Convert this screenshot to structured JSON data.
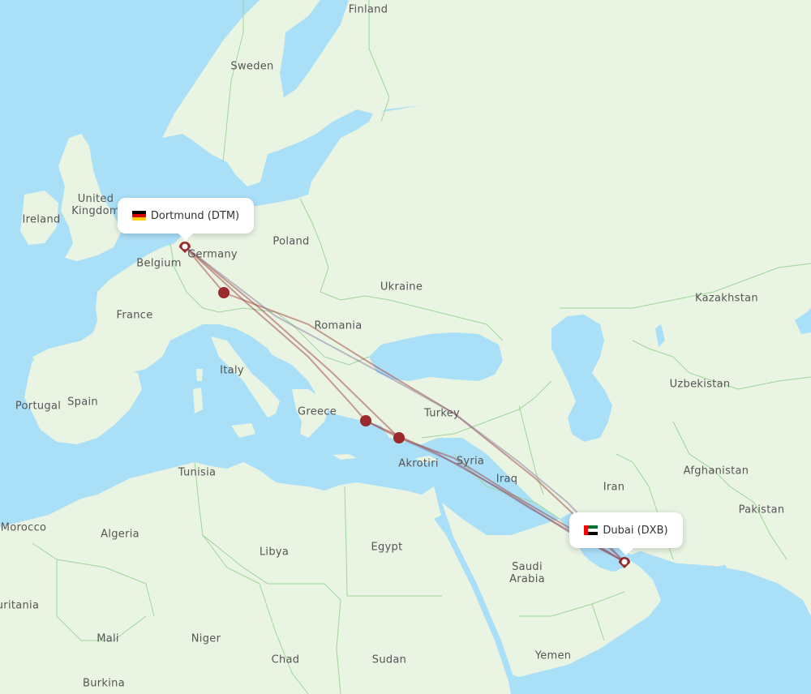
{
  "map": {
    "colors": {
      "water": "#aadff8",
      "land": "#eaf4e3",
      "border": "#9fd49a",
      "route": "#a0403f",
      "marker": "#9a2a2c"
    },
    "origin": {
      "label": "Dortmund (DTM)",
      "city": "Dortmund",
      "code": "DTM",
      "flag": "germany-flag"
    },
    "destination": {
      "label": "Dubai (DXB)",
      "city": "Dubai",
      "code": "DXB",
      "flag": "uae-flag"
    },
    "stopovers": [
      "Munich area",
      "Izmir area",
      "Antalya area"
    ],
    "country_labels": {
      "finland": "Finland",
      "sweden": "Sweden",
      "united_kingdom": "United\nKingdom",
      "ireland": "Ireland",
      "poland": "Poland",
      "germany": "Germany",
      "belgium": "Belgium",
      "ukraine": "Ukraine",
      "france": "France",
      "romania": "Romania",
      "kazakhstan": "Kazakhstan",
      "italy": "Italy",
      "uzbekistan": "Uzbekistan",
      "portugal": "Portugal",
      "spain": "Spain",
      "greece": "Greece",
      "turkey": "Turkey",
      "akrotiri": "Akrotiri",
      "syria": "Syria",
      "tunisia": "Tunisia",
      "afghanistan": "Afghanistan",
      "iraq": "Iraq",
      "iran": "Iran",
      "pakistan": "Pakistan",
      "morocco": "Morocco",
      "algeria": "Algeria",
      "libya": "Libya",
      "egypt": "Egypt",
      "saudi_arabia": "Saudi\nArabia",
      "mauritania": "uritania",
      "mali": "Mali",
      "niger": "Niger",
      "chad": "Chad",
      "sudan": "Sudan",
      "yemen": "Yemen",
      "burkina": "Burkina"
    }
  }
}
